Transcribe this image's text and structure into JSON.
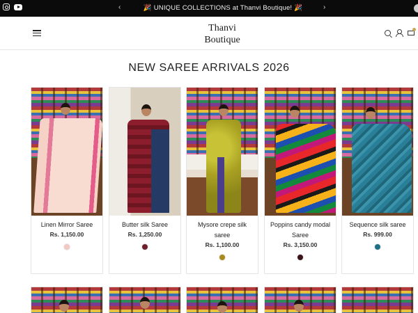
{
  "announcement": {
    "text": "UNIQUE COLLECTIONS at Thanvi Boutique!",
    "emoji": "🎉",
    "prev_arrow": "‹",
    "next_arrow": "›"
  },
  "header": {
    "brand_line1": "Thanvi",
    "brand_line2": "Boutique"
  },
  "icons": [
    "instagram-icon",
    "youtube-icon",
    "menu-icon",
    "search-icon",
    "account-icon",
    "cart-icon"
  ],
  "section": {
    "title": "NEW SAREE ARRIVALS 2026"
  },
  "products": [
    {
      "name": "Linen Mirror Saree",
      "price": "Rs. 1,150.00",
      "swatch": "#f2c9c2"
    },
    {
      "name": "Butter silk Saree",
      "price": "Rs. 1,250.00",
      "swatch": "#6e1f2a"
    },
    {
      "name": "Mysore crepe silk saree",
      "price": "Rs. 1,100.00",
      "swatch": "#a88a1e"
    },
    {
      "name": "Poppins candy modal Saree",
      "price": "Rs. 3,150.00",
      "swatch": "#3a1418"
    },
    {
      "name": "Sequence silk saree",
      "price": "Rs. 999.00",
      "swatch": "#1f6f86"
    }
  ],
  "colors": {
    "announcement_bg": "#0b0b0b",
    "accent": "#c8a75a"
  }
}
